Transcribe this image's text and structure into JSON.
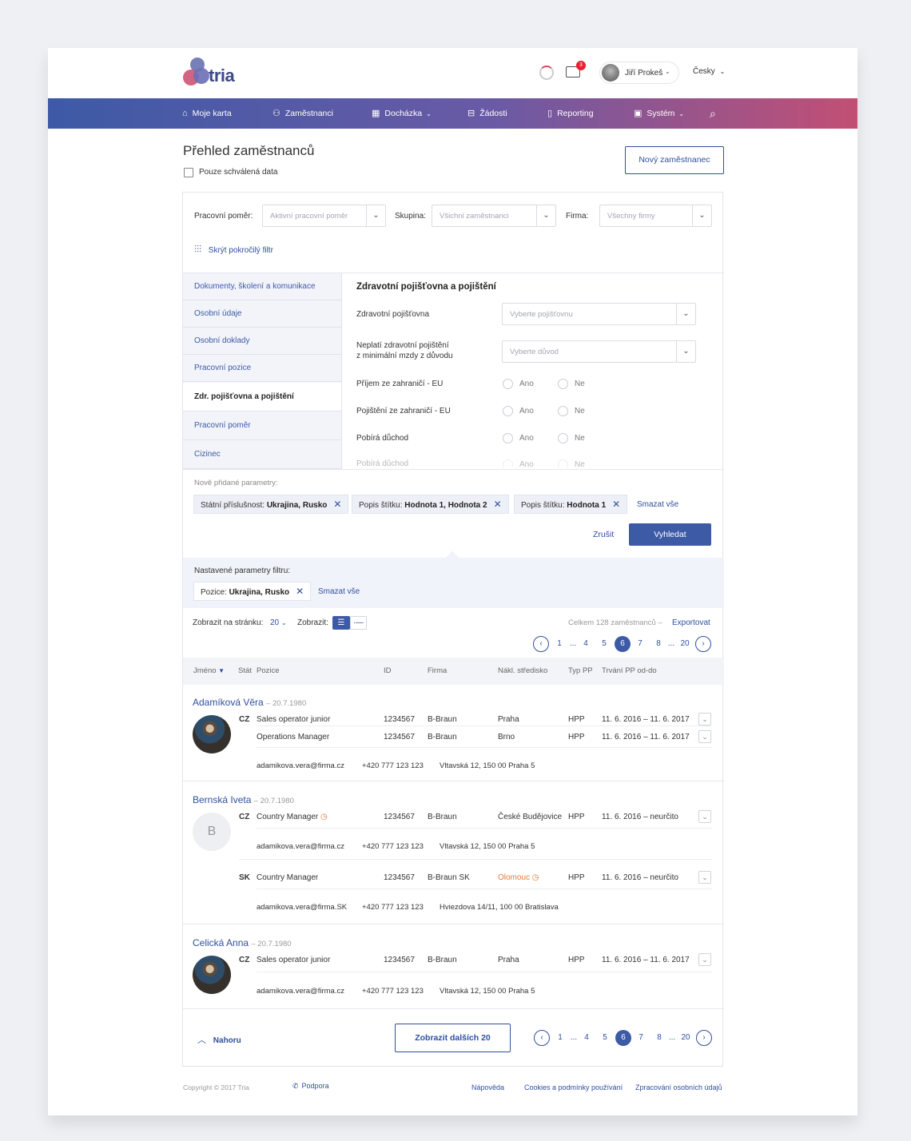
{
  "header": {
    "logo_text": "tria",
    "notification_count": "3",
    "user_name": "Jiří Prokeš",
    "language": "Česky"
  },
  "nav": [
    {
      "label": "Moje karta",
      "icon": "home-icon"
    },
    {
      "label": "Zaměstnanci",
      "icon": "user-icon"
    },
    {
      "label": "Docházka",
      "icon": "calendar-icon"
    },
    {
      "label": "Žádosti",
      "icon": "inbox-icon"
    },
    {
      "label": "Reporting",
      "icon": "document-icon"
    },
    {
      "label": "Systém",
      "icon": "grid-icon"
    }
  ],
  "page": {
    "title": "Přehled zaměstnanců",
    "approved_only_label": "Pouze schválená data",
    "new_employee_button": "Nový zaměstnanec"
  },
  "filters": {
    "employment_label": "Pracovní poměr:",
    "employment_placeholder": "Aktivní pracovní poměr",
    "group_label": "Skupina:",
    "group_placeholder": "Všichni zaměstnanci",
    "company_label": "Firma:",
    "company_placeholder": "Všechny firmy",
    "hide_advanced": "Skrýt pokročilý filtr"
  },
  "advanced": {
    "sidebar": [
      "Dokumenty, školení a komunikace",
      "Osobní údaje",
      "Osobní doklady",
      "Pracovní pozice",
      "Zdr. pojišťovna a pojištění",
      "Pracovní poměr",
      "Cizinec"
    ],
    "section_title": "Zdravotní pojišťovna a pojištění",
    "insurance_label": "Zdravotní pojišťovna",
    "insurance_placeholder": "Vyberte pojišťovnu",
    "min_wage_label_1": "Neplatí zdravotní pojištění",
    "min_wage_label_2": "z minimální mzdy z důvodu",
    "reason_placeholder": "Vyberte důvod",
    "yes": "Ano",
    "no": "Ne",
    "radio_rows": [
      "Příjem ze zahraničí - EU",
      "Pojištění ze zahraničí - EU",
      "Pobírá důchod",
      "Pobírá důchod"
    ]
  },
  "new_params": {
    "label": "Nově přidané parametry:",
    "chips": [
      {
        "key": "Státní příslušnost:",
        "value": "Ukrajina, Rusko"
      },
      {
        "key": "Popis štítku:",
        "value": "Hodnota 1, Hodnota 2"
      },
      {
        "key": "Popis štítku:",
        "value": "Hodnota 1"
      }
    ],
    "clear_all": "Smazat vše",
    "cancel": "Zrušit",
    "search": "Vyhledat"
  },
  "set_params": {
    "label": "Nastavené parametry filtru:",
    "chip_key": "Pozice:",
    "chip_value": "Ukrajina, Rusko",
    "clear_all": "Smazat vše"
  },
  "list_controls": {
    "per_page_label": "Zobrazit na stránku:",
    "per_page_value": "20",
    "view_label": "Zobrazit:",
    "total": "Celkem 128 zaměstnanců –",
    "export": "Exportovat"
  },
  "pagination": [
    "1",
    "...",
    "4",
    "5",
    "6",
    "7",
    "8",
    "...",
    "20"
  ],
  "table_headers": [
    "Jméno",
    "Stát",
    "Pozice",
    "ID",
    "Firma",
    "Nákl. středisko",
    "Typ PP",
    "Trvání PP od-do"
  ],
  "employees": [
    {
      "name": "Adamíková Věra",
      "birth": "– 20.7.1980",
      "initial": "",
      "rows": [
        {
          "country": "CZ",
          "position": "Sales operator junior",
          "id": "1234567",
          "company": "B-Braun",
          "center": "Praha",
          "type": "HPP",
          "duration": "11. 6. 2016 – 11. 6. 2017"
        },
        {
          "country": "",
          "position": "Operations Manager",
          "id": "1234567",
          "company": "B-Braun",
          "center": "Brno",
          "type": "HPP",
          "duration": "11. 6. 2016 – 11. 6. 2017"
        }
      ],
      "contacts": [
        {
          "email": "adamikova.vera@firma.cz",
          "phone": "+420 777 123 123",
          "address": "Vltavská 12, 150 00 Praha 5"
        }
      ]
    },
    {
      "name": "Bernská Iveta",
      "birth": "– 20.7.1980",
      "initial": "B",
      "rows": [
        {
          "country": "CZ",
          "position": "Country Manager",
          "id": "1234567",
          "company": "B-Braun",
          "center": "České Budějovice",
          "type": "HPP",
          "duration": "11. 6. 2016 – neurčito"
        },
        {
          "country": "SK",
          "position": "Country Manager",
          "id": "1234567",
          "company": "B-Braun SK",
          "center": "Olomouc",
          "type": "HPP",
          "duration": "11. 6. 2016 – neurčito"
        }
      ],
      "contacts": [
        {
          "email": "adamikova.vera@firma.cz",
          "phone": "+420 777 123 123",
          "address": "Vltavská 12, 150 00 Praha 5"
        },
        {
          "email": "adamikova.vera@firma.SK",
          "phone": "+420 777 123 123",
          "address": "Hviezdova 14/11, 100 00 Bratislava"
        }
      ]
    },
    {
      "name": "Celická Anna",
      "birth": "– 20.7.1980",
      "initial": "",
      "rows": [
        {
          "country": "CZ",
          "position": "Sales operator junior",
          "id": "1234567",
          "company": "B-Braun",
          "center": "Praha",
          "type": "HPP",
          "duration": "11. 6. 2016 – 11. 6. 2017"
        }
      ],
      "contacts": [
        {
          "email": "adamikova.vera@firma.cz",
          "phone": "+420 777 123 123",
          "address": "Vltavská 12, 150 00 Praha 5"
        }
      ]
    }
  ],
  "bottom": {
    "to_top": "Nahoru",
    "load_more": "Zobrazit dalších 20"
  },
  "footer": {
    "copyright": "Copyright © 2017 Tria",
    "support": "Podpora",
    "help": "Nápověda",
    "cookies": "Cookies a podmínky používání",
    "gdpr": "Zpracování osobních údajů"
  },
  "colors": {
    "primary": "#3d5aa6",
    "accent": "#c24f74",
    "link": "#2f4f9e",
    "warning": "#e07b39"
  }
}
